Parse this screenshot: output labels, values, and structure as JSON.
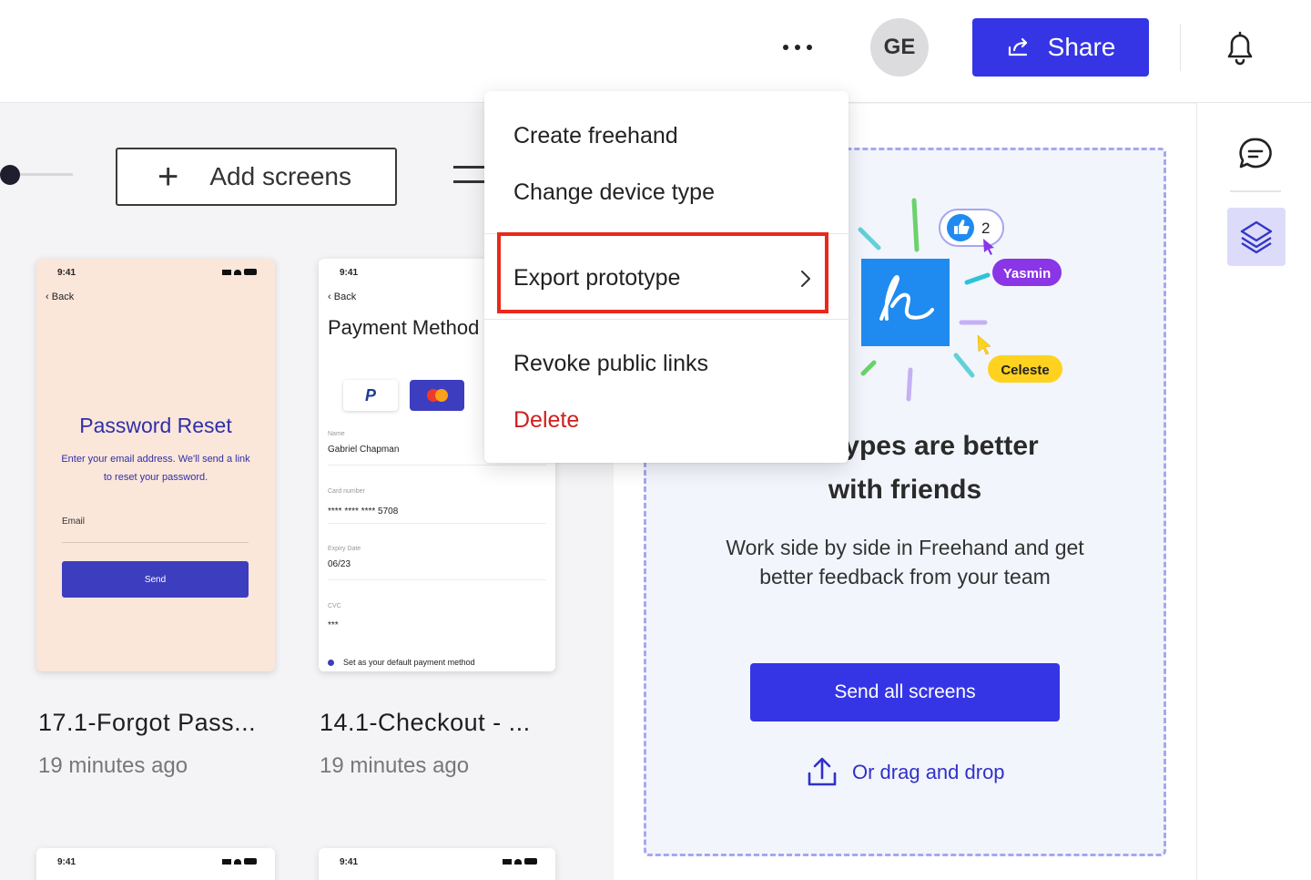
{
  "topbar": {
    "more_icon": "more-horizontal-icon",
    "avatar_initials": "GE",
    "share_label": "Share",
    "share_icon": "share-arrow-icon",
    "bell_icon": "bell-icon"
  },
  "rightrail": {
    "comment_icon": "comment-icon",
    "layers_icon": "layers-icon"
  },
  "toolbar": {
    "add_screens_label": "Add screens",
    "plus_symbol": "+"
  },
  "cards": [
    {
      "name": "17.1-Forgot Pass...",
      "time": "19 minutes ago",
      "preview": {
        "status_time": "9:41",
        "back_label": "Back",
        "title": "Password Reset",
        "description": "Enter your email address. We'll send a link to reset your password.",
        "email_label": "Email",
        "send_label": "Send"
      }
    },
    {
      "name": "14.1-Checkout - ...",
      "time": "19 minutes ago",
      "preview": {
        "status_time": "9:41",
        "back_label": "Back",
        "title": "Payment Method",
        "paypal_letter": "P",
        "name_label": "Name",
        "name_value": "Gabriel Chapman",
        "card_label": "Card number",
        "card_value": "**** **** **** 5708",
        "expiry_label": "Expiry Date",
        "expiry_value": "06/23",
        "cvc_label": "CVC",
        "cvc_value": "***",
        "default_label": "Set as your default payment method"
      }
    }
  ],
  "mini_cards": [
    {
      "status_time": "9:41"
    },
    {
      "status_time": "9:41"
    }
  ],
  "promo": {
    "heading_line1": "ypes are better",
    "heading_line2": "with friends",
    "body": "Work side by side in Freehand and get better feedback from your team",
    "like_count": "2",
    "tag_yasmin": "Yasmin",
    "tag_celeste": "Celeste",
    "send_all_label": "Send all screens",
    "drag_drop_label": "Or drag and drop",
    "upload_icon": "upload-icon",
    "colors": {
      "yasmin": "#8a35e6",
      "celeste": "#ffd21f",
      "freehand": "#1f8bf0"
    }
  },
  "dropdown": {
    "items": [
      {
        "label": "Create freehand"
      },
      {
        "label": "Change device type"
      },
      {
        "label": "Export prototype",
        "has_submenu": true,
        "highlighted": true
      },
      {
        "label": "Revoke public links"
      },
      {
        "label": "Delete",
        "danger": true
      }
    ],
    "chevron_icon": "chevron-right-icon"
  },
  "colors": {
    "accent": "#3535e6",
    "danger": "#cf1f1f",
    "highlight_border": "#e8291c"
  }
}
